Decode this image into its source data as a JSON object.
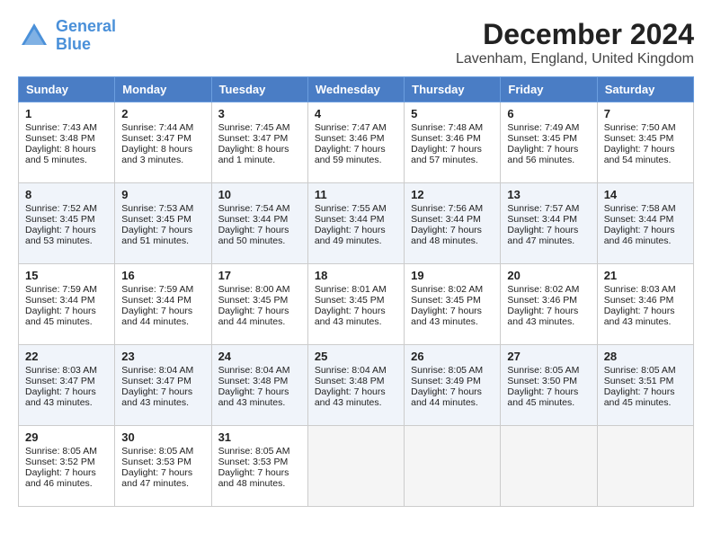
{
  "header": {
    "logo_line1": "General",
    "logo_line2": "Blue",
    "month": "December 2024",
    "location": "Lavenham, England, United Kingdom"
  },
  "days_of_week": [
    "Sunday",
    "Monday",
    "Tuesday",
    "Wednesday",
    "Thursday",
    "Friday",
    "Saturday"
  ],
  "weeks": [
    [
      {
        "day": "1",
        "sunrise": "7:43 AM",
        "sunset": "3:48 PM",
        "daylight": "8 hours and 5 minutes."
      },
      {
        "day": "2",
        "sunrise": "7:44 AM",
        "sunset": "3:47 PM",
        "daylight": "8 hours and 3 minutes."
      },
      {
        "day": "3",
        "sunrise": "7:45 AM",
        "sunset": "3:47 PM",
        "daylight": "8 hours and 1 minute."
      },
      {
        "day": "4",
        "sunrise": "7:47 AM",
        "sunset": "3:46 PM",
        "daylight": "7 hours and 59 minutes."
      },
      {
        "day": "5",
        "sunrise": "7:48 AM",
        "sunset": "3:46 PM",
        "daylight": "7 hours and 57 minutes."
      },
      {
        "day": "6",
        "sunrise": "7:49 AM",
        "sunset": "3:45 PM",
        "daylight": "7 hours and 56 minutes."
      },
      {
        "day": "7",
        "sunrise": "7:50 AM",
        "sunset": "3:45 PM",
        "daylight": "7 hours and 54 minutes."
      }
    ],
    [
      {
        "day": "8",
        "sunrise": "7:52 AM",
        "sunset": "3:45 PM",
        "daylight": "7 hours and 53 minutes."
      },
      {
        "day": "9",
        "sunrise": "7:53 AM",
        "sunset": "3:45 PM",
        "daylight": "7 hours and 51 minutes."
      },
      {
        "day": "10",
        "sunrise": "7:54 AM",
        "sunset": "3:44 PM",
        "daylight": "7 hours and 50 minutes."
      },
      {
        "day": "11",
        "sunrise": "7:55 AM",
        "sunset": "3:44 PM",
        "daylight": "7 hours and 49 minutes."
      },
      {
        "day": "12",
        "sunrise": "7:56 AM",
        "sunset": "3:44 PM",
        "daylight": "7 hours and 48 minutes."
      },
      {
        "day": "13",
        "sunrise": "7:57 AM",
        "sunset": "3:44 PM",
        "daylight": "7 hours and 47 minutes."
      },
      {
        "day": "14",
        "sunrise": "7:58 AM",
        "sunset": "3:44 PM",
        "daylight": "7 hours and 46 minutes."
      }
    ],
    [
      {
        "day": "15",
        "sunrise": "7:59 AM",
        "sunset": "3:44 PM",
        "daylight": "7 hours and 45 minutes."
      },
      {
        "day": "16",
        "sunrise": "7:59 AM",
        "sunset": "3:44 PM",
        "daylight": "7 hours and 44 minutes."
      },
      {
        "day": "17",
        "sunrise": "8:00 AM",
        "sunset": "3:45 PM",
        "daylight": "7 hours and 44 minutes."
      },
      {
        "day": "18",
        "sunrise": "8:01 AM",
        "sunset": "3:45 PM",
        "daylight": "7 hours and 43 minutes."
      },
      {
        "day": "19",
        "sunrise": "8:02 AM",
        "sunset": "3:45 PM",
        "daylight": "7 hours and 43 minutes."
      },
      {
        "day": "20",
        "sunrise": "8:02 AM",
        "sunset": "3:46 PM",
        "daylight": "7 hours and 43 minutes."
      },
      {
        "day": "21",
        "sunrise": "8:03 AM",
        "sunset": "3:46 PM",
        "daylight": "7 hours and 43 minutes."
      }
    ],
    [
      {
        "day": "22",
        "sunrise": "8:03 AM",
        "sunset": "3:47 PM",
        "daylight": "7 hours and 43 minutes."
      },
      {
        "day": "23",
        "sunrise": "8:04 AM",
        "sunset": "3:47 PM",
        "daylight": "7 hours and 43 minutes."
      },
      {
        "day": "24",
        "sunrise": "8:04 AM",
        "sunset": "3:48 PM",
        "daylight": "7 hours and 43 minutes."
      },
      {
        "day": "25",
        "sunrise": "8:04 AM",
        "sunset": "3:48 PM",
        "daylight": "7 hours and 43 minutes."
      },
      {
        "day": "26",
        "sunrise": "8:05 AM",
        "sunset": "3:49 PM",
        "daylight": "7 hours and 44 minutes."
      },
      {
        "day": "27",
        "sunrise": "8:05 AM",
        "sunset": "3:50 PM",
        "daylight": "7 hours and 45 minutes."
      },
      {
        "day": "28",
        "sunrise": "8:05 AM",
        "sunset": "3:51 PM",
        "daylight": "7 hours and 45 minutes."
      }
    ],
    [
      {
        "day": "29",
        "sunrise": "8:05 AM",
        "sunset": "3:52 PM",
        "daylight": "7 hours and 46 minutes."
      },
      {
        "day": "30",
        "sunrise": "8:05 AM",
        "sunset": "3:53 PM",
        "daylight": "7 hours and 47 minutes."
      },
      {
        "day": "31",
        "sunrise": "8:05 AM",
        "sunset": "3:53 PM",
        "daylight": "7 hours and 48 minutes."
      },
      null,
      null,
      null,
      null
    ]
  ]
}
